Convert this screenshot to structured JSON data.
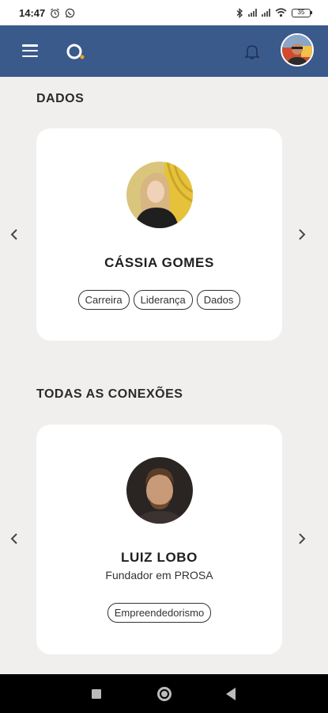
{
  "status_bar": {
    "time": "14:47",
    "icons": [
      "alarm-icon",
      "whatsapp-icon",
      "bluetooth-icon",
      "signal-icon",
      "signal-icon",
      "wifi-icon"
    ],
    "battery": "35"
  },
  "header": {
    "background": "#3b5a8c",
    "accent": "#f0a020",
    "icons": [
      "menu-icon",
      "logo-icon",
      "bell-icon"
    ]
  },
  "sections": [
    {
      "title": "DADOS",
      "card": {
        "name": "CÁSSIA GOMES",
        "role": "",
        "tags": [
          "Carreira",
          "Liderança",
          "Dados"
        ]
      }
    },
    {
      "title": "TODAS AS CONEXÕES",
      "card": {
        "name": "LUIZ LOBO",
        "role": "Fundador em PROSA",
        "tags": [
          "Empreendedorismo"
        ]
      }
    }
  ],
  "nav": {
    "icons": [
      "recents-icon",
      "home-icon",
      "back-icon"
    ]
  }
}
